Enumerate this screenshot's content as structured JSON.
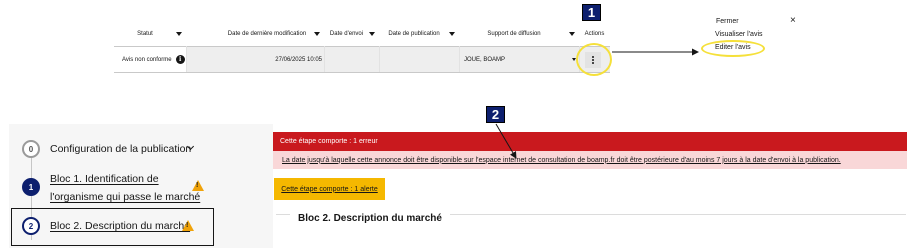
{
  "table": {
    "headers": [
      {
        "label": "Statut",
        "sortable": true
      },
      {
        "label": "Date de dernière modification",
        "sortable": true
      },
      {
        "label": "Date d'envoi",
        "sortable": true
      },
      {
        "label": "Date de publication",
        "sortable": true
      },
      {
        "label": "Support de diffusion",
        "sortable": true
      },
      {
        "label": "Actions",
        "sortable": false
      }
    ],
    "row": {
      "status": "Avis non conforme",
      "status_info_icon": "i",
      "last_modified": "27/06/2025 10:05",
      "sent_date": "",
      "publication_date": "",
      "support": "JOUE, BOAMP",
      "actions_icon": "kebab-menu-icon"
    }
  },
  "menu": {
    "items": [
      "Fermer",
      "Visualiser l'avis",
      "Editer l'avis"
    ],
    "close_icon": "×"
  },
  "annotations": {
    "badge1": "1",
    "badge2": "2",
    "highlight_color": "#f5e03a"
  },
  "stepper": {
    "step0": {
      "number": "0",
      "label": "Configuration de la publication"
    },
    "step1": {
      "number": "1",
      "label_line1": "Bloc 1. Identification de",
      "label_line2": "l'organisme qui passe le marché",
      "warning": "!"
    },
    "step2": {
      "number": "2",
      "label": "Bloc 2. Description du marché",
      "warning": "!"
    }
  },
  "content": {
    "error_header": "Cette étape comporte : 1 erreur",
    "error_message": "La date jusqu'à laquelle cette annonce doit être disponible sur l'espace internet de consultation de boamp.fr doit être postérieure d'au moins 7 jours à la date d'envoi à la publication.",
    "alert_button": "Cette étape comporte : 1 alerte",
    "section_title": "Bloc 2. Description du marché"
  },
  "colors": {
    "error_red": "#c9191e",
    "error_light": "#f9d7d8",
    "alert_yellow": "#f5b800",
    "navy": "#0d1f6e",
    "warning_orange": "#f0a30a"
  }
}
